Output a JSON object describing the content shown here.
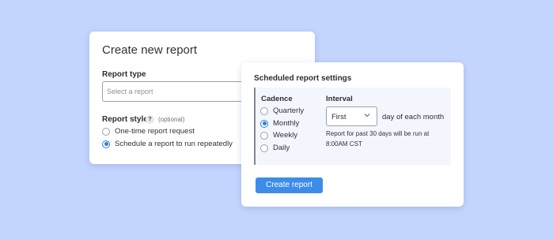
{
  "create_card": {
    "title": "Create new report",
    "report_type_label": "Report type",
    "select_placeholder": "Select a report",
    "report_style_label": "Report style",
    "help_glyph": "?",
    "optional_text": "(optional)",
    "options": [
      "One-time report request",
      "Schedule a report to run repeatedly"
    ],
    "selected_option": "Schedule a report to run repeatedly"
  },
  "schedule_card": {
    "title": "Scheduled report settings",
    "cadence_label": "Cadence",
    "cadence_options": [
      "Quarterly",
      "Monthly",
      "Weekly",
      "Daily"
    ],
    "cadence_selected": "Monthly",
    "interval_label": "Interval",
    "interval_value": "First",
    "interval_suffix": "day of each month",
    "note_line1": "Report for past 30 days will be run at",
    "note_line2": "8:00AM CST",
    "create_button": "Create report"
  },
  "icons": {
    "chevron": "chevron-down-icon",
    "help": "help-icon"
  },
  "colors": {
    "background": "#c3d4fe",
    "accent": "#3d8ce9",
    "panel": "#f3f6fd"
  }
}
